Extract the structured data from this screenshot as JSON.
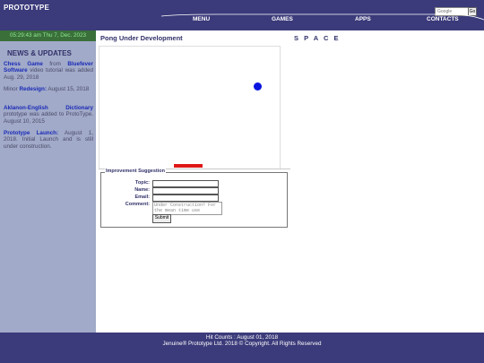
{
  "header": {
    "logo": "PROTOTYPE",
    "search_placeholder": "Google",
    "search_button": "Go"
  },
  "nav": {
    "menu": "MENU",
    "games": "GAMES",
    "apps": "APPS",
    "contacts": "CONTACTS"
  },
  "sidebar": {
    "clock": "05:29:43 am Thu 7, Dec. 2023",
    "news_title": "NEWS & UPDATES",
    "news": [
      {
        "bold1": "Chess Game",
        "text1": " from ",
        "bold2": "Bluefever Software",
        "text2": " video tutorial was added Aug. 29, 2018"
      },
      {
        "text1": "Minor ",
        "bold1": "Redesign:",
        "text2": " August 15, 2018"
      },
      {
        "bold1": "Aklanon-English Dictionary",
        "text1": " prototype was added to ProtoType. August 10, 2015"
      },
      {
        "bold1": "Prototype Launch:",
        "text1": " August 1, 2018. Initial Launch and is still under construction."
      }
    ]
  },
  "main": {
    "title": "Pong Under Development",
    "space_title": "S P A C E"
  },
  "form": {
    "legend": "Improvement Suggestion",
    "topic_label": "Topic:",
    "name_label": "Name:",
    "email_label": "Email:",
    "comment_label": "Comment:",
    "comment_placeholder": "Under Construction? For the mean time use",
    "submit": "Submit"
  },
  "footer": {
    "hit_counts": "Hit Counts :    August 01, 2018",
    "copyright": "Jenuine® Prototype Ltd. 2018 © Copyright. All Rights Reserved"
  },
  "colors": {
    "header_bg": "#3b3a7a",
    "sidebar_bg": "#a1aac8",
    "clock_bg": "#3a6f3a",
    "ball": "#0a14e0",
    "paddle": "#e01818"
  }
}
